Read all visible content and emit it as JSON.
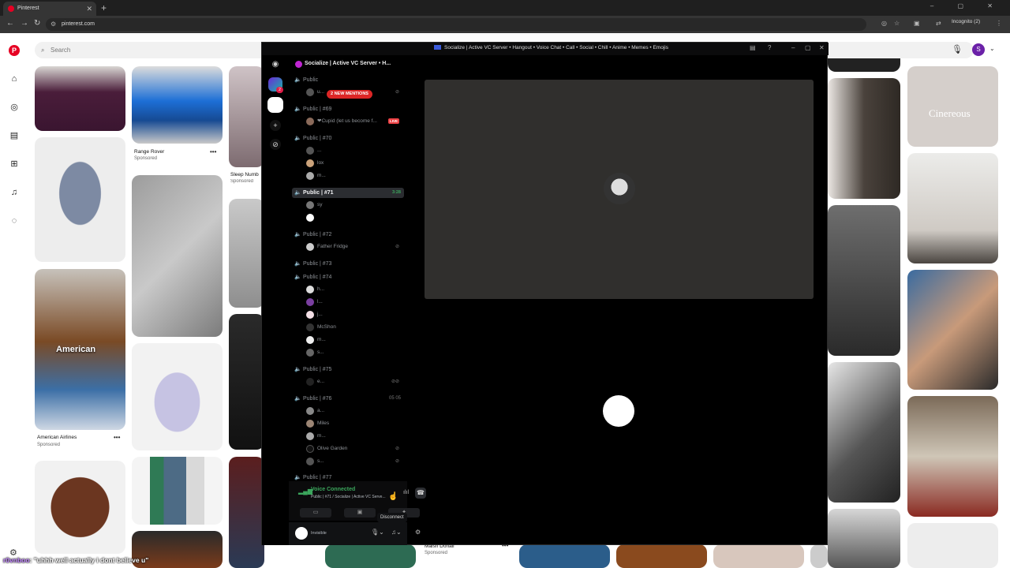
{
  "browser": {
    "tab_title": "Pinterest",
    "url": "pinterest.com",
    "incognito_label": "Incognito (2)",
    "profile_initial": "S"
  },
  "pinterest": {
    "search_placeholder": "Search",
    "pins": {
      "range_rover": {
        "title": "Range Rover",
        "sub": "Sponsored"
      },
      "sleep_number": {
        "title": "Sleep Numb",
        "sub": "Sponsored"
      },
      "american_airlines": {
        "title": "American Airlines",
        "sub": "Sponsored",
        "overlay": "American"
      },
      "cinereous": {
        "overlay": "Cinereous"
      },
      "maison": {
        "title": "Maisn Donall",
        "sub": "Sponsored"
      }
    }
  },
  "discord": {
    "window_title": "Socialize | Active VC Server • Hangout • Voice Chat • Call • Social • Chill • Anime • Memes • Emojis",
    "server_name": "Socialize | Active VC Server • H...",
    "mentions_pill": "2 NEW MENTIONS",
    "guild_badge": "2",
    "channels": [
      {
        "name": "Public",
        "members": [
          {
            "name": "u..."
          }
        ]
      },
      {
        "name": "Public | #69",
        "members": [
          {
            "name": "❤Cupid (let us become f...",
            "live": "LIVE"
          }
        ]
      },
      {
        "name": "Public | #70",
        "members": [
          {
            "name": "..."
          },
          {
            "name": "lox"
          },
          {
            "name": "m..."
          }
        ]
      },
      {
        "name": "Public | #71",
        "time": "3:28",
        "members": [
          {
            "name": "sy"
          },
          {
            "name": ""
          }
        ]
      },
      {
        "name": "Public | #72",
        "members": [
          {
            "name": "Father Fridge"
          }
        ]
      },
      {
        "name": "Public | #73",
        "members": []
      },
      {
        "name": "Public | #74",
        "members": [
          {
            "name": "h..."
          },
          {
            "name": "l..."
          },
          {
            "name": "j..."
          },
          {
            "name": "McShon"
          },
          {
            "name": "m..."
          },
          {
            "name": "s..."
          }
        ]
      },
      {
        "name": "Public | #75",
        "members": [
          {
            "name": "e..."
          }
        ]
      },
      {
        "name": "Public | #76",
        "counts": "05  05",
        "members": [
          {
            "name": "a..."
          },
          {
            "name": "Miles"
          },
          {
            "name": "m..."
          },
          {
            "name": "Olive Garden"
          },
          {
            "name": "s..."
          }
        ]
      },
      {
        "name": "Public | #77",
        "members": []
      }
    ],
    "voice": {
      "status": "Voice Connected",
      "sub": "Public | #71 / Socialize | Active VC Serve...",
      "tooltip": "Disconnect"
    },
    "user": {
      "status": "Invisible"
    }
  },
  "stream_caption": {
    "name": "r0vnboo",
    "text": ": \"uhhh well actually i dont believe u\""
  },
  "colors": {
    "pinterest_red": "#e60023",
    "discord_green": "#3ba55c",
    "live_red": "#ed4245"
  }
}
